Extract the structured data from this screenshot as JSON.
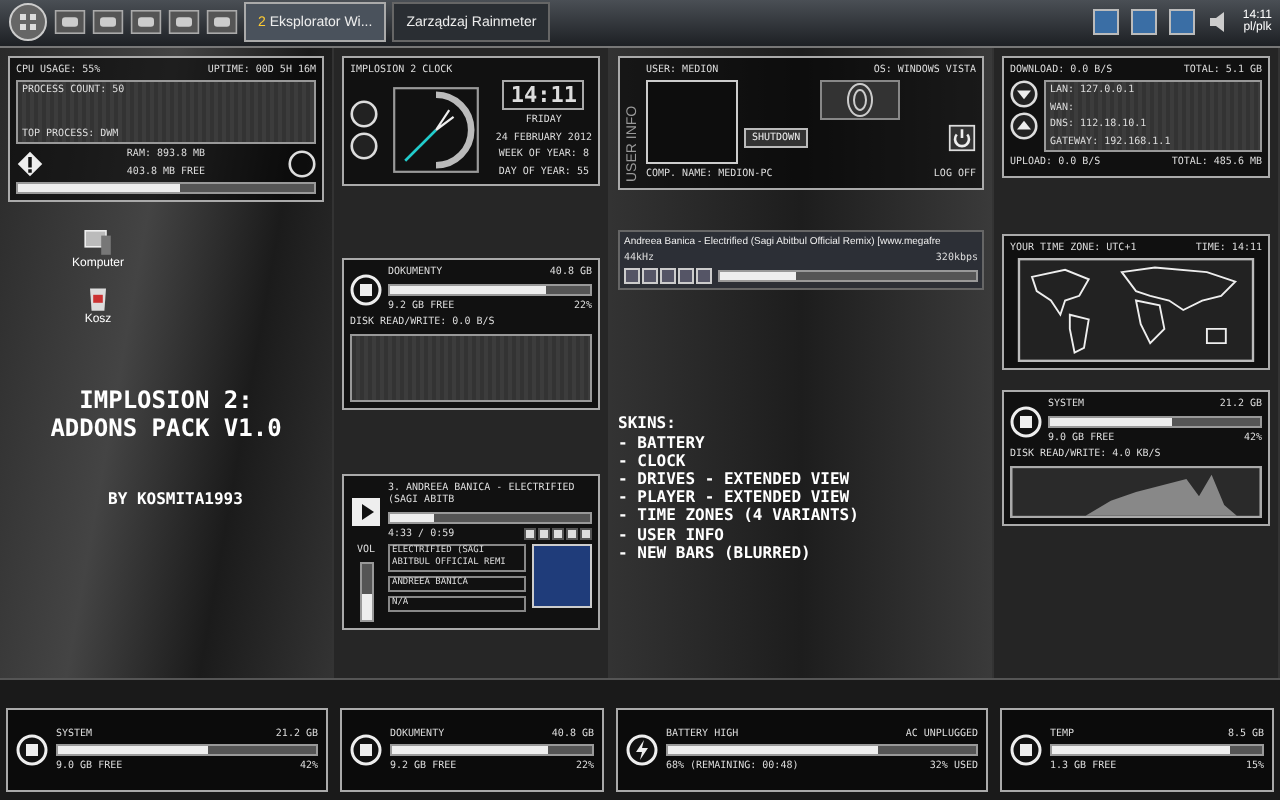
{
  "taskbar": {
    "tasks": [
      {
        "count": "2",
        "label": "Eksplorator Wi...",
        "selected": true
      },
      {
        "label": "Zarządzaj Rainmeter",
        "selected": false
      }
    ],
    "clock": "14:11",
    "language": "pl/plk"
  },
  "cpu": {
    "usage": "CPU USAGE: 55%",
    "uptime": "UPTIME: 00D 5H 16M",
    "process_count": "PROCESS COUNT: 50",
    "top_process": "TOP PROCESS: DWM",
    "ram": "RAM: 893.8 MB",
    "ram_free": "403.8 MB FREE",
    "level": 0.55
  },
  "clock": {
    "title": "IMPLOSION 2 CLOCK",
    "time": "14:11",
    "day": "FRIDAY",
    "date": "24 FEBRUARY 2012",
    "week": "WEEK OF YEAR: 8",
    "day_of_year": "DAY OF YEAR: 55"
  },
  "user_info": {
    "heading": "USER INFO",
    "user": "USER: MEDION",
    "os": "OS: WINDOWS VISTA",
    "shutdown": "SHUTDOWN",
    "computer": "COMP. NAME: MEDION-PC",
    "logoff": "LOG OFF"
  },
  "network": {
    "download": "DOWNLOAD: 0.0 B/S",
    "download_total": "TOTAL: 5.1 GB",
    "lan": "LAN: 127.0.0.1",
    "wan": "WAN:",
    "dns": "DNS: 112.18.10.1",
    "gateway": "GATEWAY: 192.168.1.1",
    "upload": "UPLOAD: 0.0 B/S",
    "upload_total": "TOTAL: 485.6 MB"
  },
  "desktop": {
    "icons": [
      {
        "kind": "computer",
        "label": "Komputer"
      },
      {
        "kind": "bin",
        "label": "Kosz"
      }
    ],
    "title": [
      "IMPLOSION 2:",
      "ADDONS PACK V1.0"
    ],
    "author": "BY KOSMITA1993"
  },
  "documents_drive": {
    "name": "DOKUMENTY",
    "size": "40.8 GB",
    "free": "9.2 GB FREE",
    "percent": "22%",
    "level": 0.78,
    "disk_activity": "DISK READ/WRITE: 0.0 B/S"
  },
  "player": {
    "track": "3. ANDREEA BANICA - ELECTRIFIED (SAGI ABITB",
    "time": "4:33 / 0:59",
    "level": 0.22,
    "volume_label": "VOL",
    "volume": {
      "level": 0.45
    },
    "title": "ELECTRIFIED (SAGI ABITBUL OFFICIAL REMI",
    "artist": "ANDREEA BANICA",
    "album": "N/A"
  },
  "media_player": {
    "title": "Andreea Banica - Electrified (Sagi Abitbul Official Remix) [www.megafre",
    "rate": "44kHz",
    "bitrate": "320kbps",
    "level": 0.3
  },
  "skins": {
    "heading": "SKINS:",
    "items": [
      "- BATTERY",
      "- CLOCK",
      "- DRIVES - EXTENDED VIEW",
      "- PLAYER - EXTENDED VIEW",
      "- TIME ZONES (4 VARIANTS)",
      "- USER INFO",
      "- NEW BARS (BLURRED)"
    ]
  },
  "time_zone": {
    "zone": "YOUR TIME ZONE: UTC+1",
    "time": "TIME: 14:11"
  },
  "system_drive": {
    "name": "SYSTEM",
    "size": "21.2 GB",
    "free": "9.0 GB FREE",
    "percent": "42%",
    "level": 0.58,
    "disk_activity": "DISK READ/WRITE: 4.0 KB/S"
  },
  "bottom_bar": [
    {
      "kind": "drive",
      "name": "SYSTEM",
      "size": "21.2 GB",
      "free": "9.0 GB FREE",
      "percent": "42%",
      "level": 0.58
    },
    {
      "kind": "drive",
      "name": "DOKUMENTY",
      "size": "40.8 GB",
      "free": "9.2 GB FREE",
      "percent": "22%",
      "level": 0.78
    },
    {
      "kind": "battery",
      "name": "BATTERY HIGH",
      "size": "AC UNPLUGGED",
      "free": "68% (REMAINING: 00:48)",
      "percent": "32% USED",
      "level": 0.68
    },
    {
      "kind": "drive",
      "name": "TEMP",
      "size": "8.5 GB",
      "free": "1.3 GB FREE",
      "percent": "15%",
      "level": 0.85
    }
  ]
}
